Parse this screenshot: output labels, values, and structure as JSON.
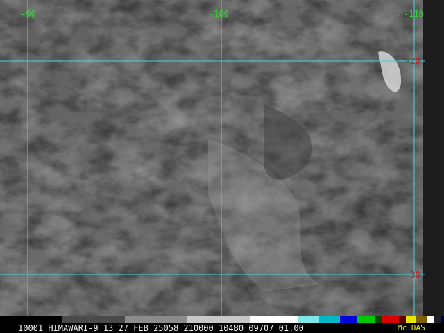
{
  "map": {
    "lon_labels": [
      "-90",
      "-100",
      "-110"
    ],
    "lat_labels": [
      "-20",
      "-30"
    ],
    "grid_color": "#38d8e0",
    "lon_label_color": "#34d334",
    "lat_label_color": "#c01818"
  },
  "footer": {
    "status": "10001 HIMAWARI-9 13 27 FEB 25058 210000 10480 09707 01.00",
    "brand": "McIDAS",
    "brand_color": "#e8e800"
  },
  "colorbar": {
    "stops": [
      "#000000",
      "#4a4a4a",
      "#8c8c8c",
      "#c8c8c8",
      "#ffffff",
      "#7ee8e8",
      "#00b8c8",
      "#0000d8",
      "#00c800",
      "#004800",
      "#d80000",
      "#600000",
      "#e8e800",
      "#806000",
      "#ffffff",
      "#202020",
      "#000040"
    ]
  }
}
